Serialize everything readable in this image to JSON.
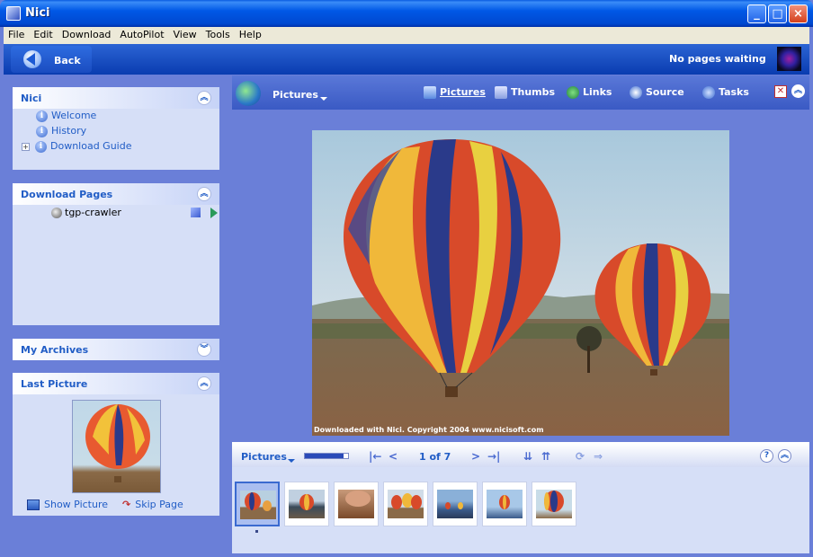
{
  "window": {
    "title": "Nici"
  },
  "menu": [
    "File",
    "Edit",
    "Download",
    "AutoPilot",
    "View",
    "Tools",
    "Help"
  ],
  "nav": {
    "back_label": "Back",
    "status": "No pages waiting"
  },
  "panels": {
    "nici": {
      "title": "Nici",
      "items": [
        "Welcome",
        "History",
        "Download Guide"
      ]
    },
    "download_pages": {
      "title": "Download Pages",
      "item": "tgp-crawler"
    },
    "my_archives": {
      "title": "My Archives"
    },
    "last_picture": {
      "title": "Last Picture",
      "show_label": "Show Picture",
      "skip_label": "Skip Page"
    }
  },
  "viewer": {
    "title": "Pictures",
    "buttons": [
      "Pictures",
      "Thumbs",
      "Links",
      "Source",
      "Tasks"
    ],
    "active": "Pictures",
    "credit": "Downloaded with Nici. Copyright 2004 www.nicisoft.com"
  },
  "filmbar": {
    "title": "Pictures",
    "page_count": "1 of 7",
    "progress": 0.9
  },
  "filmstrip": {
    "count": 7,
    "selected_index": 0
  },
  "colors": {
    "accent": "#215dc6",
    "titlebar": "#0058e6",
    "panel_bg": "#d6dff7",
    "pane_bg": "#6a7fd8"
  }
}
